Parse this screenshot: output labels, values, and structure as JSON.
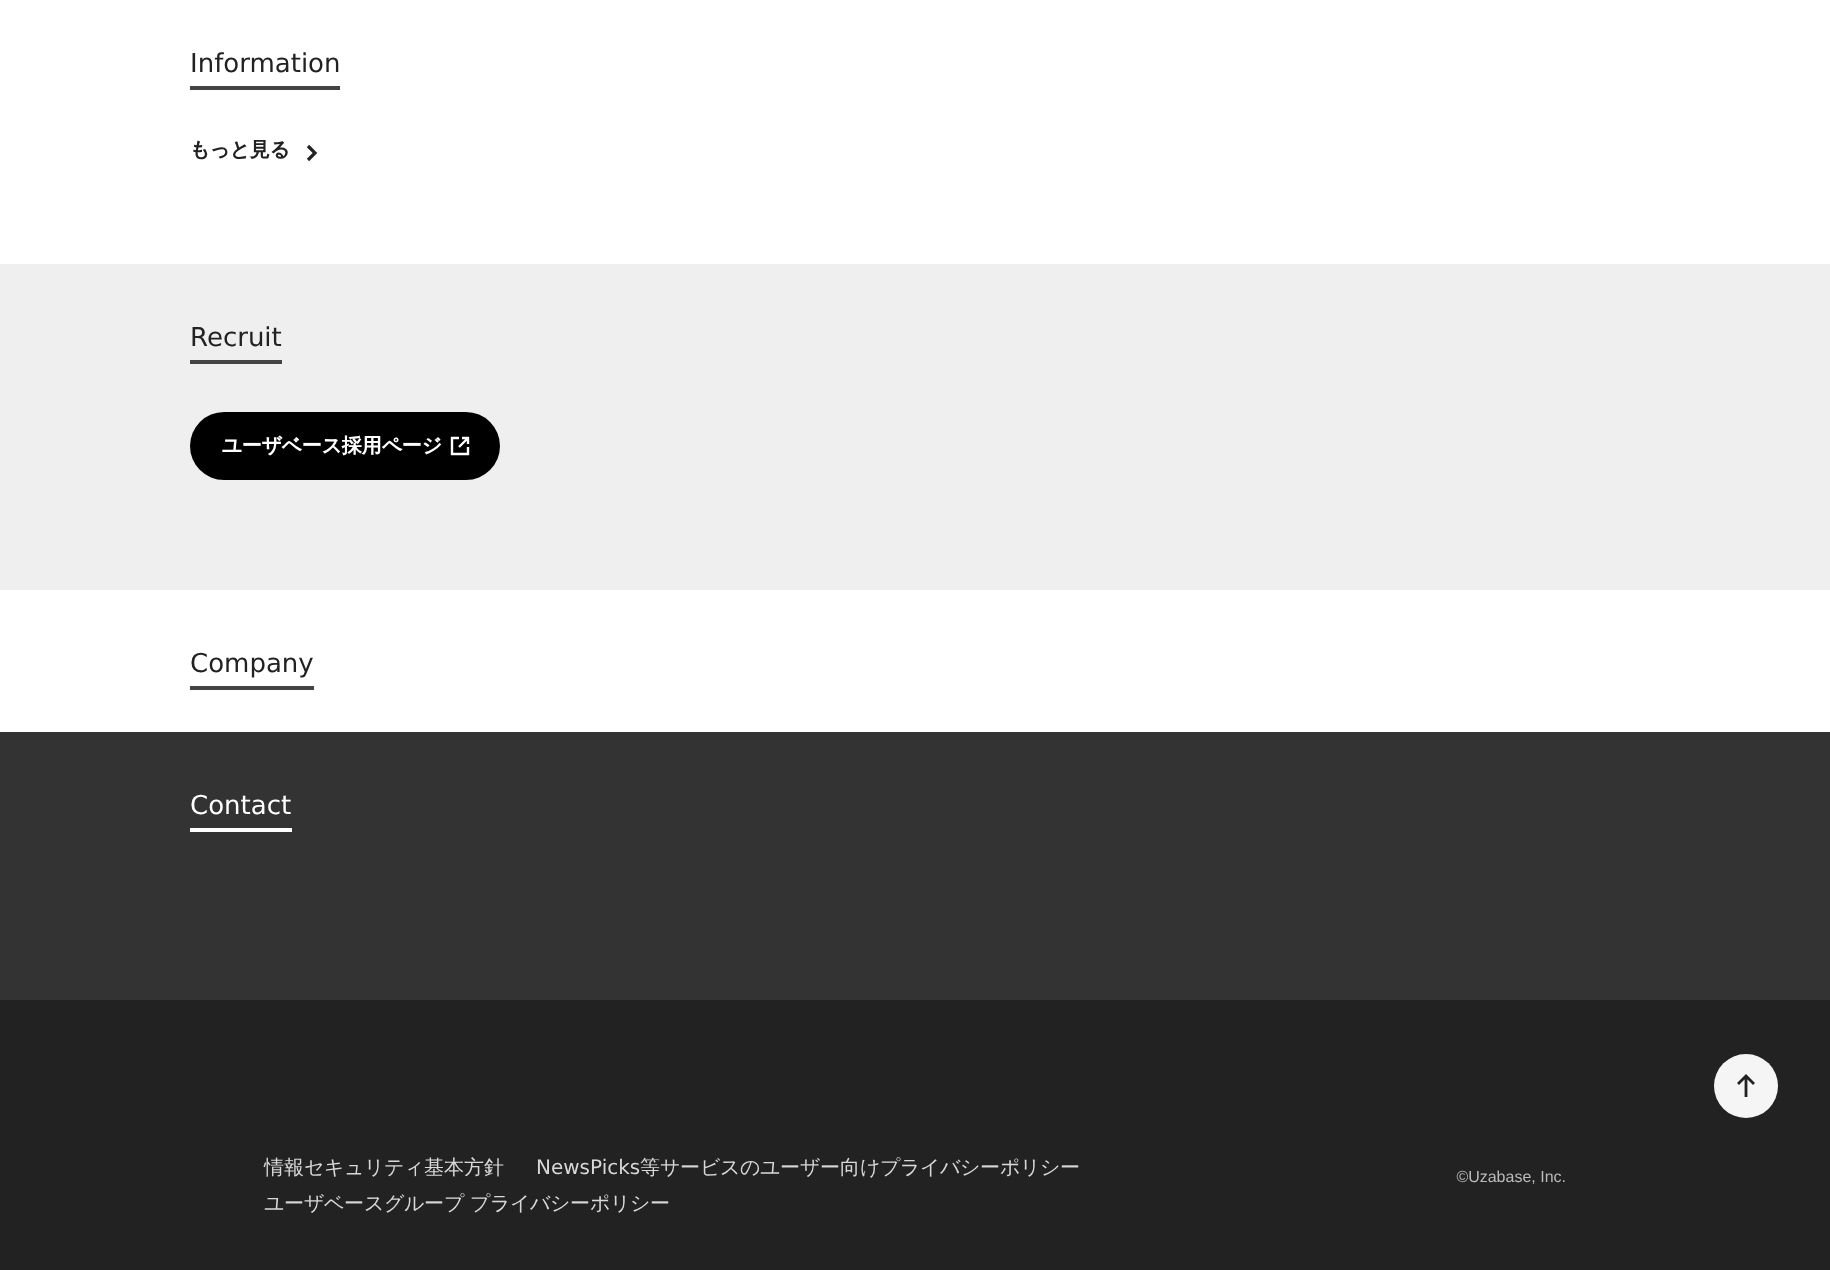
{
  "sections": [
    {
      "kind": "plain",
      "heading": "Information",
      "more_link": {
        "label": "もっと見る"
      }
    },
    {
      "kind": "shaded",
      "heading": "Recruit",
      "button": {
        "label": "ユーザベース採用ページ"
      }
    },
    {
      "kind": "plain",
      "heading": "Company"
    },
    {
      "kind": "dark",
      "heading": "Contact"
    }
  ],
  "footer": {
    "links": [
      "情報セキュリティ基本方針",
      "NewsPicks等サービスのユーザー向けプライバシーポリシー",
      "ユーザベースグループ プライバシーポリシー"
    ],
    "copyright": "©Uzabase, Inc."
  }
}
